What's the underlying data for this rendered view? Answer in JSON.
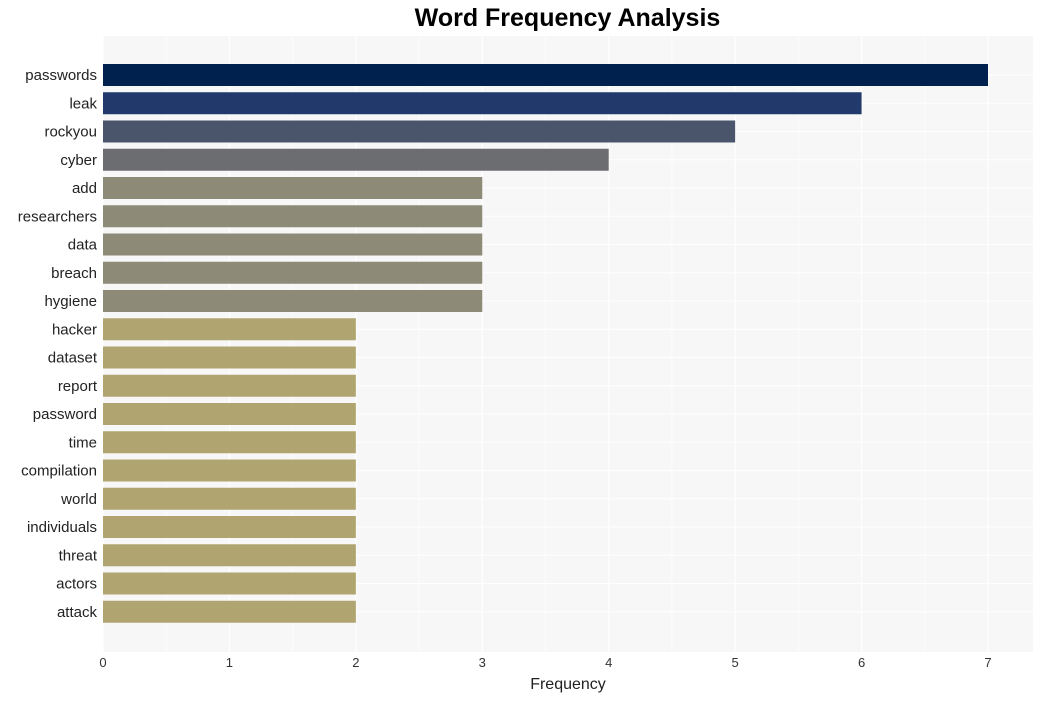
{
  "chart_data": {
    "type": "bar",
    "orientation": "horizontal",
    "title": "Word Frequency Analysis",
    "xlabel": "Frequency",
    "ylabel": "",
    "xlim": [
      0,
      7.35
    ],
    "xticks": [
      "0",
      "1",
      "2",
      "3",
      "4",
      "5",
      "6",
      "7"
    ],
    "grid": true,
    "categories": [
      "passwords",
      "leak",
      "rockyou",
      "cyber",
      "add",
      "researchers",
      "data",
      "breach",
      "hygiene",
      "hacker",
      "dataset",
      "report",
      "password",
      "time",
      "compilation",
      "world",
      "individuals",
      "threat",
      "actors",
      "attack"
    ],
    "values": [
      7,
      6,
      5,
      4,
      3,
      3,
      3,
      3,
      3,
      2,
      2,
      2,
      2,
      2,
      2,
      2,
      2,
      2,
      2,
      2
    ],
    "colors": [
      "#00214d",
      "#213a6b",
      "#4a546b",
      "#6c6d70",
      "#8e8a78",
      "#8e8a78",
      "#8e8a78",
      "#8e8a78",
      "#8e8a78",
      "#b0a570",
      "#b0a570",
      "#b0a570",
      "#b0a570",
      "#b0a570",
      "#b0a570",
      "#b0a570",
      "#b0a570",
      "#b0a570",
      "#b0a570",
      "#b0a570"
    ]
  }
}
